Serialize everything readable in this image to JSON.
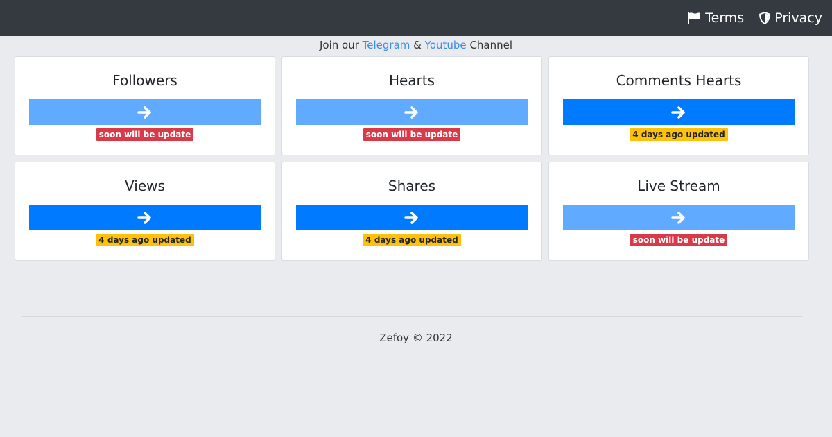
{
  "nav": {
    "terms_label": "Terms",
    "privacy_label": "Privacy"
  },
  "join": {
    "prefix": "Join our",
    "telegram": "Telegram",
    "amp": "&",
    "youtube": "Youtube",
    "suffix": "Channel"
  },
  "cards": [
    {
      "title": "Followers",
      "status": "soon will be update",
      "status_type": "danger",
      "enabled": false
    },
    {
      "title": "Hearts",
      "status": "soon will be update",
      "status_type": "danger",
      "enabled": false
    },
    {
      "title": "Comments Hearts",
      "status": "4 days ago updated",
      "status_type": "warning",
      "enabled": true
    },
    {
      "title": "Views",
      "status": "4 days ago updated",
      "status_type": "warning",
      "enabled": true
    },
    {
      "title": "Shares",
      "status": "4 days ago updated",
      "status_type": "warning",
      "enabled": true
    },
    {
      "title": "Live Stream",
      "status": "soon will be update",
      "status_type": "danger",
      "enabled": false
    }
  ],
  "footer": {
    "text": "Zefoy © 2022"
  },
  "colors": {
    "navbar": "#343a40",
    "primary": "#007bff",
    "primary_disabled": "#60aaff",
    "danger": "#d93a49",
    "warning": "#ffc10a",
    "link": "#3b8ee8",
    "background": "#e9ebee"
  },
  "icons": {
    "terms": "flag-icon",
    "privacy": "shield-icon",
    "card_button": "arrow-right-icon"
  }
}
